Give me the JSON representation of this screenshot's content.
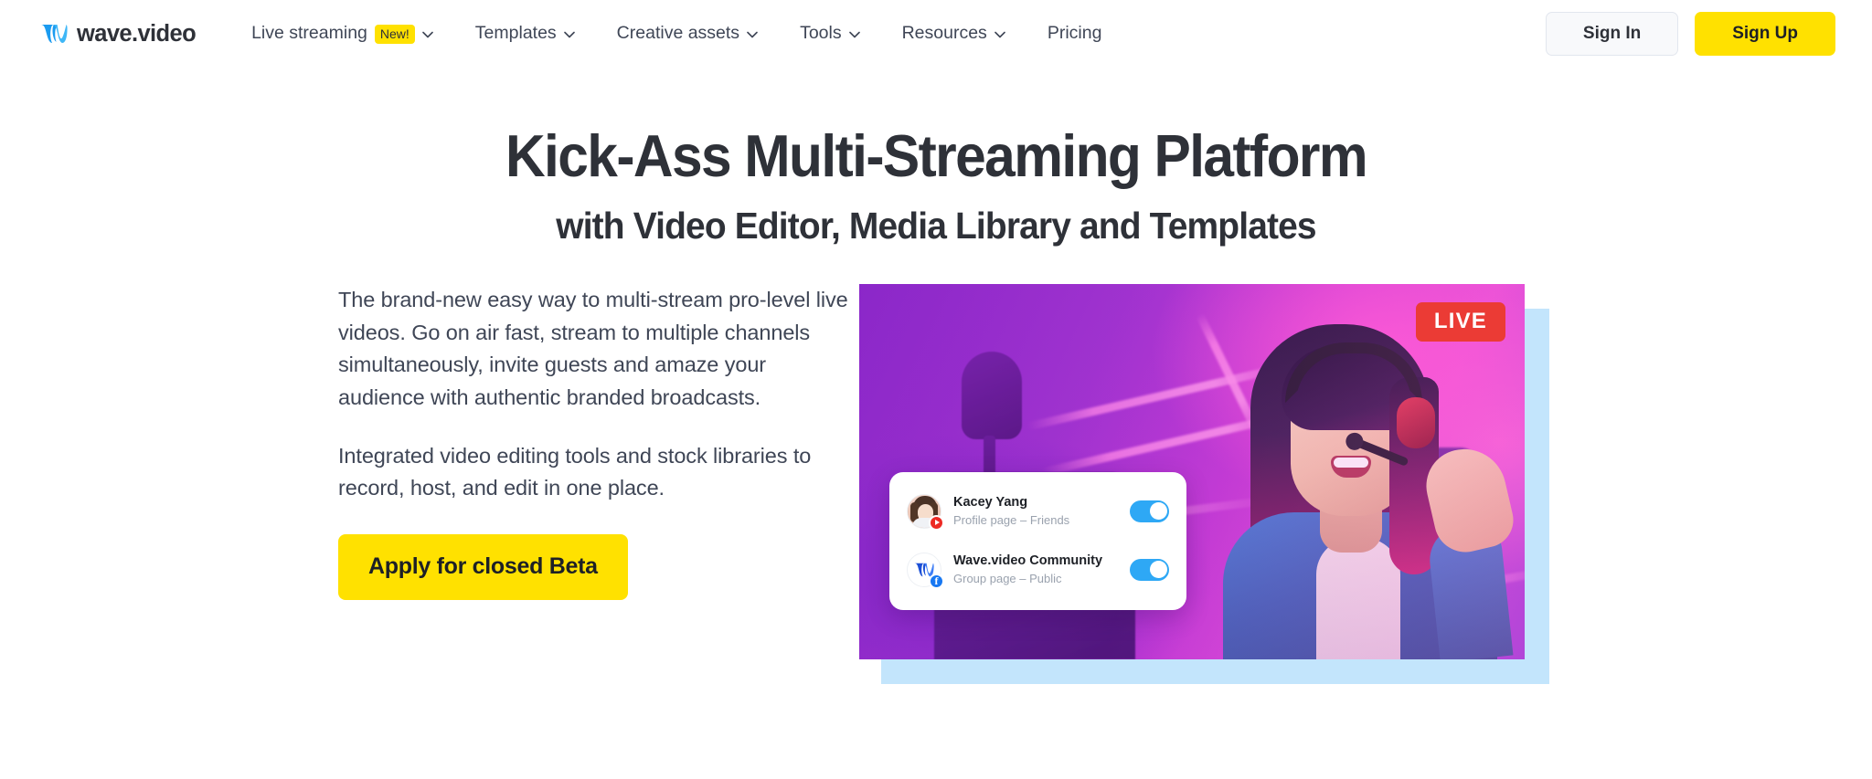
{
  "header": {
    "brand": {
      "name": "wave.video",
      "icon": "wave-logo-icon",
      "color": "#1b9bf0"
    },
    "nav": [
      {
        "label": "Live streaming",
        "badge": "New!",
        "has_dropdown": true
      },
      {
        "label": "Templates",
        "badge": null,
        "has_dropdown": true
      },
      {
        "label": "Creative assets",
        "badge": null,
        "has_dropdown": true
      },
      {
        "label": "Tools",
        "badge": null,
        "has_dropdown": true
      },
      {
        "label": "Resources",
        "badge": null,
        "has_dropdown": true
      },
      {
        "label": "Pricing",
        "badge": null,
        "has_dropdown": false
      }
    ],
    "sign_in_label": "Sign In",
    "sign_up_label": "Sign Up"
  },
  "hero": {
    "title": "Kick-Ass Multi-Streaming Platform",
    "subtitle": "with Video Editor, Media Library and Templates",
    "paragraph_1": "The brand-new easy way to multi-stream pro-level live videos. Go on air fast, stream to multiple channels simultaneously, invite guests and amaze your audience with authentic branded broadcasts.",
    "paragraph_2": "Integrated video editing tools and stock libraries to record, host, and edit in one place.",
    "cta_label": "Apply for closed Beta"
  },
  "media": {
    "live_badge": "LIVE",
    "destinations": [
      {
        "name": "Kacey Yang",
        "description": "Profile page – Friends",
        "platform_icon": "youtube-icon",
        "avatar_icon": "user-avatar",
        "toggle_on": true
      },
      {
        "name": "Wave.video Community",
        "description": "Group page – Public",
        "platform_icon": "facebook-icon",
        "avatar_icon": "wave-logo-icon",
        "toggle_on": true
      }
    ]
  },
  "colors": {
    "brand_yellow": "#ffe100",
    "brand_blue": "#1b9bf0",
    "live_red": "#eb3b35",
    "frame_blue": "#c3e5fc",
    "text_dark": "#2e3138",
    "text_body": "#3f4656"
  }
}
